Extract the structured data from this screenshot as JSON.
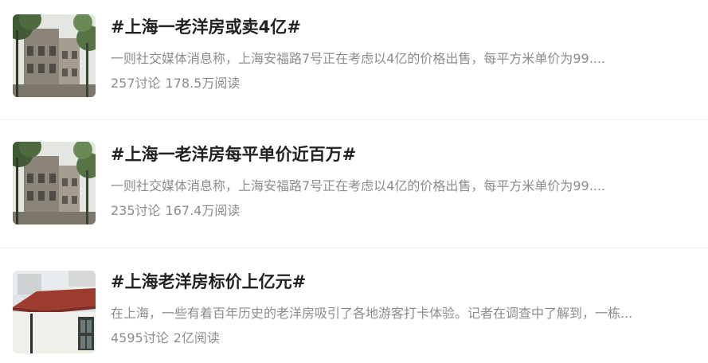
{
  "topics": [
    {
      "thumbnail": "old-house-photo",
      "title": "#上海一老洋房或卖4亿#",
      "desc": "一则社交媒体消息称，上海安福路7号正在考虑以4亿的价格出售，每平方米单价为99....",
      "discussions": "257讨论",
      "reads": "178.5万阅读"
    },
    {
      "thumbnail": "old-house-photo",
      "title": "#上海一老洋房每平单价近百万#",
      "desc": "一则社交媒体消息称，上海安福路7号正在考虑以4亿的价格出售，每平方米单价为99....",
      "discussions": "235讨论",
      "reads": "167.4万阅读"
    },
    {
      "thumbnail": "villa-roof-photo",
      "title": "#上海老洋房标价上亿元#",
      "desc": "在上海，一些有着百年历史的老洋房吸引了各地游客打卡体验。记者在调查中了解到，一栋...",
      "discussions": "4595讨论",
      "reads": "2亿阅读"
    }
  ]
}
